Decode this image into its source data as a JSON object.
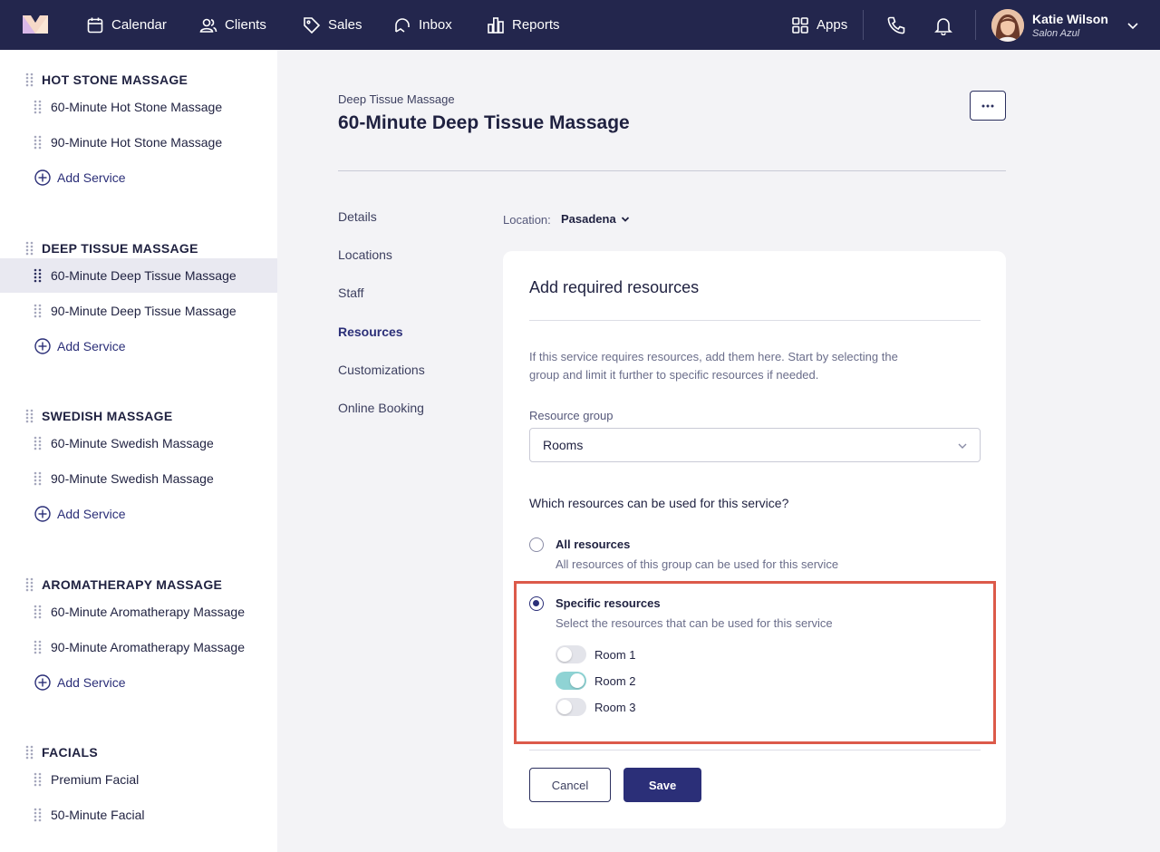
{
  "nav": {
    "items": [
      {
        "label": "Calendar",
        "icon": "calendar-icon"
      },
      {
        "label": "Clients",
        "icon": "clients-icon"
      },
      {
        "label": "Sales",
        "icon": "tag-icon"
      },
      {
        "label": "Inbox",
        "icon": "inbox-icon"
      },
      {
        "label": "Reports",
        "icon": "reports-icon"
      }
    ],
    "apps_label": "Apps",
    "user": {
      "name": "Katie Wilson",
      "salon": "Salon Azul"
    },
    "colors": {
      "bar": "#23264d",
      "accent": "#2b2f78"
    }
  },
  "sidebar": {
    "add_label": "Add Service",
    "categories": [
      {
        "title": "HOT STONE MASSAGE",
        "services": [
          "60-Minute Hot Stone Massage",
          "90-Minute Hot Stone Massage"
        ]
      },
      {
        "title": "DEEP TISSUE MASSAGE",
        "services": [
          "60-Minute Deep Tissue Massage",
          "90-Minute Deep Tissue Massage"
        ]
      },
      {
        "title": "SWEDISH MASSAGE",
        "services": [
          "60-Minute Swedish Massage",
          "90-Minute Swedish Massage"
        ]
      },
      {
        "title": "AROMATHERAPY MASSAGE",
        "services": [
          "60-Minute Aromatherapy Massage",
          "90-Minute Aromatherapy Massage"
        ]
      },
      {
        "title": "FACIALS",
        "services": [
          "Premium Facial",
          "50-Minute Facial"
        ]
      }
    ],
    "active_service": "60-Minute Deep Tissue Massage"
  },
  "main": {
    "breadcrumb": "Deep Tissue Massage",
    "title": "60-Minute Deep Tissue Massage",
    "tabs": [
      "Details",
      "Locations",
      "Staff",
      "Resources",
      "Customizations",
      "Online Booking"
    ],
    "active_tab": "Resources",
    "location_label": "Location:",
    "location_value": "Pasadena"
  },
  "card": {
    "title": "Add required resources",
    "description": "If this service requires resources, add them here. Start by selecting the group and limit it further to specific resources if needed.",
    "group_label": "Resource group",
    "group_value": "Rooms",
    "question": "Which resources can be used for this service?",
    "options": [
      {
        "title": "All resources",
        "subtitle": "All resources of this group can be used for this service",
        "selected": false
      },
      {
        "title": "Specific resources",
        "subtitle": "Select the resources that can be used for this service",
        "selected": true
      }
    ],
    "resources": [
      {
        "label": "Room 1",
        "enabled": false
      },
      {
        "label": "Room 2",
        "enabled": true
      },
      {
        "label": "Room 3",
        "enabled": false
      }
    ],
    "cancel_label": "Cancel",
    "save_label": "Save",
    "highlight_color": "#dc5a4a"
  }
}
